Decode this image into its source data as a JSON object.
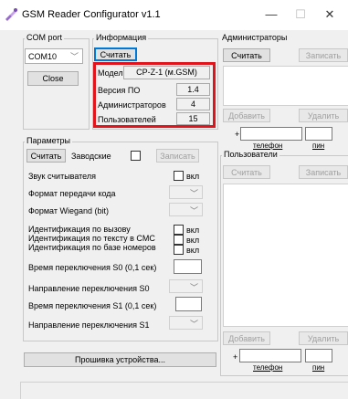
{
  "window": {
    "title": "GSM Reader Configurator v1.1"
  },
  "com": {
    "group_label": "COM port",
    "port_value": "COM10",
    "close_label": "Close"
  },
  "info": {
    "group_label": "Информация",
    "read_label": "Считать",
    "model_label": "Модель",
    "model_value": "CP-Z-1 (м.GSM)",
    "version_label": "Версия ПО",
    "version_value": "1.4",
    "admins_label": "Администраторов",
    "admins_value": "4",
    "users_label": "Пользователей",
    "users_value": "15"
  },
  "params": {
    "group_label": "Параметры",
    "read_label": "Считать",
    "factory_label": "Заводские",
    "write_label": "Записать",
    "rows": {
      "sound": "Звук считывателя",
      "code_format": "Формат передачи кода",
      "wiegand_format": "Формат Wiegand (bit)",
      "id_call": "Идентификация по вызову",
      "id_sms": "Идентификация по тексту в СМС",
      "id_db": "Идентификация по базе номеров",
      "s0_time": "Время переключения S0 (0,1 сек)",
      "s0_dir": "Направление переключения S0",
      "s1_time": "Время переключения S1 (0,1 сек)",
      "s1_dir": "Направление переключения S1"
    },
    "on_label": "вкл"
  },
  "firmware": {
    "label": "Прошивка устройства..."
  },
  "admins": {
    "group_label": "Администраторы",
    "read_label": "Считать",
    "write_label": "Записать",
    "add_label": "Добавить",
    "delete_label": "Удалить",
    "phone_prefix": "+",
    "phone_label": "телефон",
    "pin_label": "пин"
  },
  "users": {
    "group_label": "Пользователи",
    "read_label": "Считать",
    "write_label": "Записать",
    "add_label": "Добавить",
    "delete_label": "Удалить",
    "phone_prefix": "+",
    "phone_label": "телефон",
    "pin_label": "пин"
  },
  "icons": {
    "minimize": "—",
    "maximize": "☐",
    "close": "✕",
    "chevron": "﹀"
  },
  "colors": {
    "highlight": "#e3131c",
    "focus": "#0078d7"
  }
}
